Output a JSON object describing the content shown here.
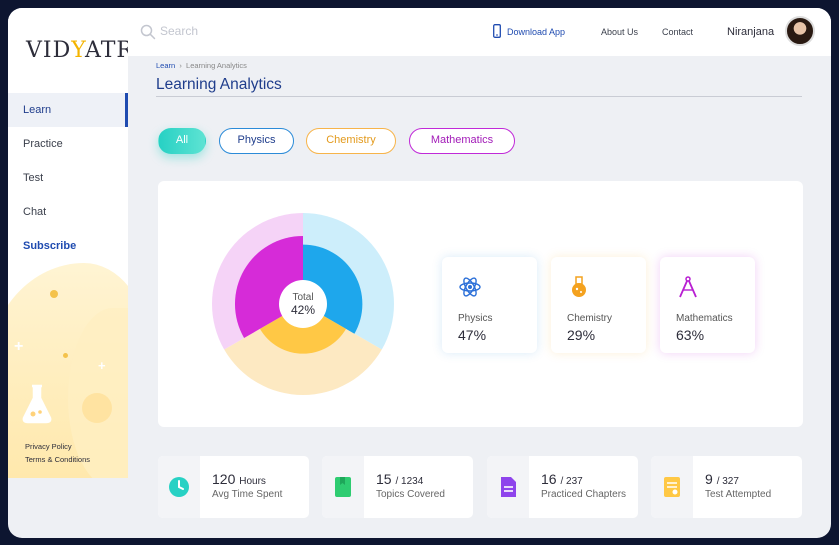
{
  "brand": {
    "logo_text_left": "VID",
    "logo_text_accent": "Y",
    "logo_text_right": "ATRI"
  },
  "sidebar": {
    "items": [
      {
        "label": "Learn",
        "active": true
      },
      {
        "label": "Practice"
      },
      {
        "label": "Test"
      },
      {
        "label": "Chat"
      },
      {
        "label": "Subscribe"
      }
    ],
    "footer": {
      "privacy": "Privacy Policy",
      "terms": "Terms & Conditions"
    }
  },
  "topbar": {
    "search_placeholder": "Search",
    "download_label": "Download App",
    "about_label": "About Us",
    "contact_label": "Contact",
    "username": "Niranjana"
  },
  "breadcrumb": {
    "root": "Learn",
    "current": "Learning Analytics"
  },
  "page_title": "Learning Analytics",
  "filters": {
    "all": "All",
    "physics": "Physics",
    "chemistry": "Chemistry",
    "mathematics": "Mathematics"
  },
  "analytics": {
    "total_label": "Total",
    "total_value": "42%",
    "subjects": [
      {
        "name": "Physics",
        "value": "47%",
        "fraction": 0.47,
        "color": "#1ea7ec",
        "outer_color": "#cdeefb"
      },
      {
        "name": "Chemistry",
        "value": "29%",
        "fraction": 0.29,
        "color": "#ffc845",
        "outer_color": "#fde9c2"
      },
      {
        "name": "Mathematics",
        "value": "63%",
        "fraction": 0.63,
        "color": "#d62bd8",
        "outer_color": "#f5d3f7"
      }
    ]
  },
  "summary": [
    {
      "value": "120",
      "unit": "Hours",
      "label": "Avg Time Spent",
      "icon": "clock-icon",
      "color": "#27d1c4"
    },
    {
      "value": "15",
      "unit": "/ 1234",
      "label": "Topics Covered",
      "icon": "book-icon",
      "color": "#2ecc71"
    },
    {
      "value": "16",
      "unit": "/ 237",
      "label": "Practiced Chapters",
      "icon": "document-icon",
      "color": "#8e44ec"
    },
    {
      "value": "9",
      "unit": "/ 327",
      "label": "Test Attempted",
      "icon": "test-icon",
      "color": "#ffc845"
    }
  ]
}
